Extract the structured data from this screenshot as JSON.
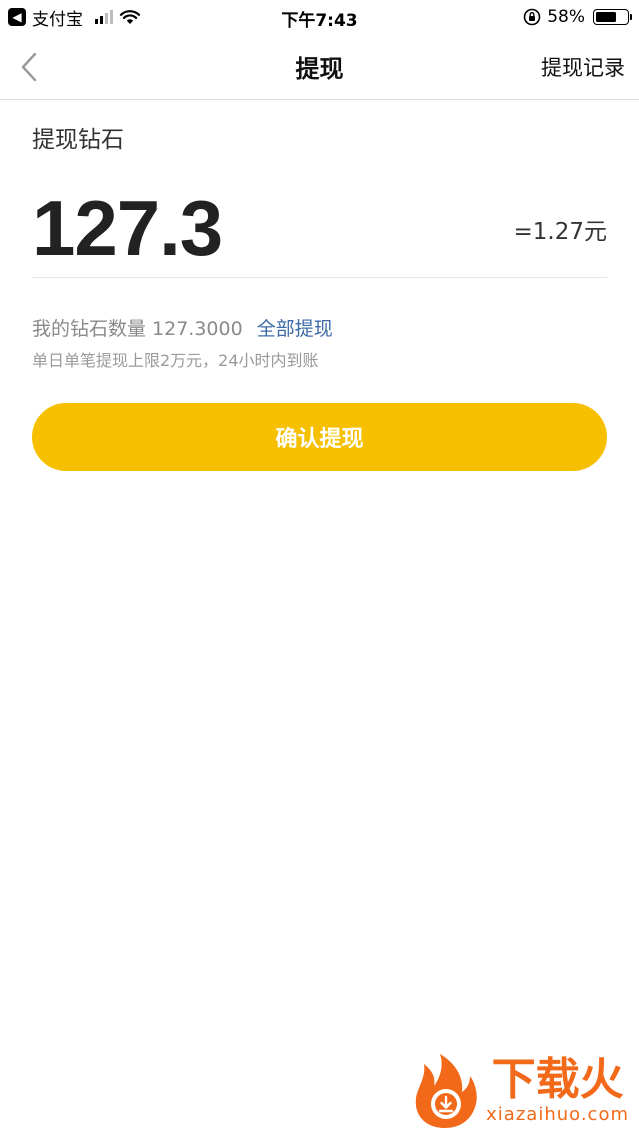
{
  "status_bar": {
    "back_app_label": "支付宝",
    "time": "下午7:43",
    "battery": "58%"
  },
  "nav": {
    "title": "提现",
    "right_link": "提现记录",
    "back_icon": "chevron-left-icon"
  },
  "withdraw": {
    "section_label": "提现钻石",
    "amount": "127.3",
    "rmb_equivalent": "=1.27元",
    "balance_text": "我的钻石数量 127.3000",
    "withdraw_all": "全部提现",
    "limit_note": "单日单笔提现上限2万元，24小时内到账",
    "confirm_button": "确认提现"
  },
  "watermark": {
    "title": "下载火",
    "sub": "xiazaihuo.com"
  },
  "colors": {
    "accent": "#f6c000",
    "link": "#3d6aa7",
    "watermark": "#f26a19"
  }
}
